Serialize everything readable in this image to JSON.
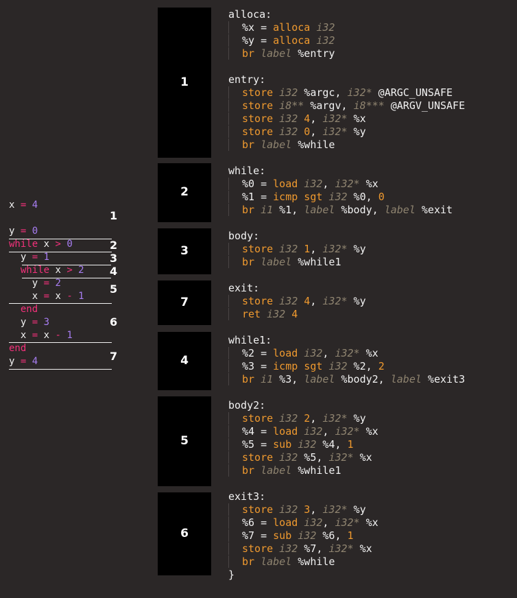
{
  "source_code": {
    "lines": [
      [
        {
          "c": "id",
          "t": "x "
        },
        {
          "c": "op",
          "t": "="
        },
        {
          "c": "num",
          "t": " 4"
        }
      ],
      [],
      [
        {
          "c": "id",
          "t": "y "
        },
        {
          "c": "op",
          "t": "="
        },
        {
          "c": "num",
          "t": " 0"
        }
      ],
      [
        {
          "c": "kw",
          "t": "while"
        },
        {
          "c": "id",
          "t": " x "
        },
        {
          "c": "op",
          "t": ">"
        },
        {
          "c": "num",
          "t": " 0"
        }
      ],
      [
        {
          "c": "id",
          "t": "  y "
        },
        {
          "c": "op",
          "t": "="
        },
        {
          "c": "num",
          "t": " 1"
        }
      ],
      [
        {
          "c": "kw",
          "t": "  while"
        },
        {
          "c": "id",
          "t": " x "
        },
        {
          "c": "op",
          "t": ">"
        },
        {
          "c": "num",
          "t": " 2"
        }
      ],
      [
        {
          "c": "id",
          "t": "    y "
        },
        {
          "c": "op",
          "t": "="
        },
        {
          "c": "num",
          "t": " 2"
        }
      ],
      [
        {
          "c": "id",
          "t": "    x "
        },
        {
          "c": "op",
          "t": "="
        },
        {
          "c": "id",
          "t": " x "
        },
        {
          "c": "op",
          "t": "-"
        },
        {
          "c": "num",
          "t": " 1"
        }
      ],
      [
        {
          "c": "kw",
          "t": "  end"
        }
      ],
      [
        {
          "c": "id",
          "t": "  y "
        },
        {
          "c": "op",
          "t": "="
        },
        {
          "c": "num",
          "t": " 3"
        }
      ],
      [
        {
          "c": "id",
          "t": "  x "
        },
        {
          "c": "op",
          "t": "="
        },
        {
          "c": "id",
          "t": " x "
        },
        {
          "c": "op",
          "t": "-"
        },
        {
          "c": "num",
          "t": " 1"
        }
      ],
      [
        {
          "c": "kw",
          "t": "end"
        }
      ],
      [
        {
          "c": "id",
          "t": "y "
        },
        {
          "c": "op",
          "t": "="
        },
        {
          "c": "num",
          "t": " 4"
        }
      ]
    ],
    "block_numbers": [
      "1",
      "2",
      "3",
      "4",
      "5",
      "6",
      "7"
    ]
  },
  "blocks": [
    "1",
    "2",
    "3",
    "7",
    "4",
    "5",
    "6"
  ],
  "ir": [
    [
      {
        "c": "w",
        "t": "alloca:"
      }
    ],
    [
      {
        "c": "i"
      },
      {
        "c": "w",
        "t": "%x = "
      },
      {
        "c": "k",
        "t": "alloca"
      },
      {
        "c": "t",
        "t": " i32"
      }
    ],
    [
      {
        "c": "i"
      },
      {
        "c": "w",
        "t": "%y = "
      },
      {
        "c": "k",
        "t": "alloca"
      },
      {
        "c": "t",
        "t": " i32"
      }
    ],
    [
      {
        "c": "i"
      },
      {
        "c": "k",
        "t": "br"
      },
      {
        "c": "t",
        "t": " label"
      },
      {
        "c": "w",
        "t": " %entry"
      }
    ],
    [],
    [
      {
        "c": "w",
        "t": "entry:"
      }
    ],
    [
      {
        "c": "i"
      },
      {
        "c": "k",
        "t": "store"
      },
      {
        "c": "t",
        "t": " i32"
      },
      {
        "c": "w",
        "t": " %argc, "
      },
      {
        "c": "t",
        "t": "i32*"
      },
      {
        "c": "w",
        "t": " @ARGC_UNSAFE"
      }
    ],
    [
      {
        "c": "i"
      },
      {
        "c": "k",
        "t": "store"
      },
      {
        "c": "t",
        "t": " i8**"
      },
      {
        "c": "w",
        "t": " %argv, "
      },
      {
        "c": "t",
        "t": "i8***"
      },
      {
        "c": "w",
        "t": " @ARGV_UNSAFE"
      }
    ],
    [
      {
        "c": "i"
      },
      {
        "c": "k",
        "t": "store"
      },
      {
        "c": "t",
        "t": " i32"
      },
      {
        "c": "n",
        "t": " 4"
      },
      {
        "c": "w",
        "t": ", "
      },
      {
        "c": "t",
        "t": "i32*"
      },
      {
        "c": "w",
        "t": " %x"
      }
    ],
    [
      {
        "c": "i"
      },
      {
        "c": "k",
        "t": "store"
      },
      {
        "c": "t",
        "t": " i32"
      },
      {
        "c": "n",
        "t": " 0"
      },
      {
        "c": "w",
        "t": ", "
      },
      {
        "c": "t",
        "t": "i32*"
      },
      {
        "c": "w",
        "t": " %y"
      }
    ],
    [
      {
        "c": "i"
      },
      {
        "c": "k",
        "t": "br"
      },
      {
        "c": "t",
        "t": " label"
      },
      {
        "c": "w",
        "t": " %while"
      }
    ],
    [],
    [
      {
        "c": "w",
        "t": "while:"
      }
    ],
    [
      {
        "c": "i"
      },
      {
        "c": "w",
        "t": "%0 = "
      },
      {
        "c": "k",
        "t": "load"
      },
      {
        "c": "t",
        "t": " i32"
      },
      {
        "c": "w",
        "t": ", "
      },
      {
        "c": "t",
        "t": "i32*"
      },
      {
        "c": "w",
        "t": " %x"
      }
    ],
    [
      {
        "c": "i"
      },
      {
        "c": "w",
        "t": "%1 = "
      },
      {
        "c": "k",
        "t": "icmp sgt"
      },
      {
        "c": "t",
        "t": " i32"
      },
      {
        "c": "w",
        "t": " %0, "
      },
      {
        "c": "n",
        "t": "0"
      }
    ],
    [
      {
        "c": "i"
      },
      {
        "c": "k",
        "t": "br"
      },
      {
        "c": "t",
        "t": " i1"
      },
      {
        "c": "w",
        "t": " %1, "
      },
      {
        "c": "t",
        "t": "label"
      },
      {
        "c": "w",
        "t": " %body, "
      },
      {
        "c": "t",
        "t": "label"
      },
      {
        "c": "w",
        "t": " %exit"
      }
    ],
    [],
    [
      {
        "c": "w",
        "t": "body:"
      }
    ],
    [
      {
        "c": "i"
      },
      {
        "c": "k",
        "t": "store"
      },
      {
        "c": "t",
        "t": " i32"
      },
      {
        "c": "n",
        "t": " 1"
      },
      {
        "c": "w",
        "t": ", "
      },
      {
        "c": "t",
        "t": "i32*"
      },
      {
        "c": "w",
        "t": " %y"
      }
    ],
    [
      {
        "c": "i"
      },
      {
        "c": "k",
        "t": "br"
      },
      {
        "c": "t",
        "t": " label"
      },
      {
        "c": "w",
        "t": " %while1"
      }
    ],
    [],
    [
      {
        "c": "w",
        "t": "exit:"
      }
    ],
    [
      {
        "c": "i"
      },
      {
        "c": "k",
        "t": "store"
      },
      {
        "c": "t",
        "t": " i32"
      },
      {
        "c": "n",
        "t": " 4"
      },
      {
        "c": "w",
        "t": ", "
      },
      {
        "c": "t",
        "t": "i32*"
      },
      {
        "c": "w",
        "t": " %y"
      }
    ],
    [
      {
        "c": "i"
      },
      {
        "c": "k",
        "t": "ret"
      },
      {
        "c": "t",
        "t": " i32"
      },
      {
        "c": "n",
        "t": " 4"
      }
    ],
    [],
    [
      {
        "c": "w",
        "t": "while1:"
      }
    ],
    [
      {
        "c": "i"
      },
      {
        "c": "w",
        "t": "%2 = "
      },
      {
        "c": "k",
        "t": "load"
      },
      {
        "c": "t",
        "t": " i32"
      },
      {
        "c": "w",
        "t": ", "
      },
      {
        "c": "t",
        "t": "i32*"
      },
      {
        "c": "w",
        "t": " %x"
      }
    ],
    [
      {
        "c": "i"
      },
      {
        "c": "w",
        "t": "%3 = "
      },
      {
        "c": "k",
        "t": "icmp sgt"
      },
      {
        "c": "t",
        "t": " i32"
      },
      {
        "c": "w",
        "t": " %2, "
      },
      {
        "c": "n",
        "t": "2"
      }
    ],
    [
      {
        "c": "i"
      },
      {
        "c": "k",
        "t": "br"
      },
      {
        "c": "t",
        "t": " i1"
      },
      {
        "c": "w",
        "t": " %3, "
      },
      {
        "c": "t",
        "t": "label"
      },
      {
        "c": "w",
        "t": " %body2, "
      },
      {
        "c": "t",
        "t": "label"
      },
      {
        "c": "w",
        "t": " %exit3"
      }
    ],
    [],
    [
      {
        "c": "w",
        "t": "body2:"
      }
    ],
    [
      {
        "c": "i"
      },
      {
        "c": "k",
        "t": "store"
      },
      {
        "c": "t",
        "t": " i32"
      },
      {
        "c": "n",
        "t": " 2"
      },
      {
        "c": "w",
        "t": ", "
      },
      {
        "c": "t",
        "t": "i32*"
      },
      {
        "c": "w",
        "t": " %y"
      }
    ],
    [
      {
        "c": "i"
      },
      {
        "c": "w",
        "t": "%4 = "
      },
      {
        "c": "k",
        "t": "load"
      },
      {
        "c": "t",
        "t": " i32"
      },
      {
        "c": "w",
        "t": ", "
      },
      {
        "c": "t",
        "t": "i32*"
      },
      {
        "c": "w",
        "t": " %x"
      }
    ],
    [
      {
        "c": "i"
      },
      {
        "c": "w",
        "t": "%5 = "
      },
      {
        "c": "k",
        "t": "sub"
      },
      {
        "c": "t",
        "t": " i32"
      },
      {
        "c": "w",
        "t": " %4, "
      },
      {
        "c": "n",
        "t": "1"
      }
    ],
    [
      {
        "c": "i"
      },
      {
        "c": "k",
        "t": "store"
      },
      {
        "c": "t",
        "t": " i32"
      },
      {
        "c": "w",
        "t": " %5, "
      },
      {
        "c": "t",
        "t": "i32*"
      },
      {
        "c": "w",
        "t": " %x"
      }
    ],
    [
      {
        "c": "i"
      },
      {
        "c": "k",
        "t": "br"
      },
      {
        "c": "t",
        "t": " label"
      },
      {
        "c": "w",
        "t": " %while1"
      }
    ],
    [],
    [
      {
        "c": "w",
        "t": "exit3:"
      }
    ],
    [
      {
        "c": "i"
      },
      {
        "c": "k",
        "t": "store"
      },
      {
        "c": "t",
        "t": " i32"
      },
      {
        "c": "n",
        "t": " 3"
      },
      {
        "c": "w",
        "t": ", "
      },
      {
        "c": "t",
        "t": "i32*"
      },
      {
        "c": "w",
        "t": " %y"
      }
    ],
    [
      {
        "c": "i"
      },
      {
        "c": "w",
        "t": "%6 = "
      },
      {
        "c": "k",
        "t": "load"
      },
      {
        "c": "t",
        "t": " i32"
      },
      {
        "c": "w",
        "t": ", "
      },
      {
        "c": "t",
        "t": "i32*"
      },
      {
        "c": "w",
        "t": " %x"
      }
    ],
    [
      {
        "c": "i"
      },
      {
        "c": "w",
        "t": "%7 = "
      },
      {
        "c": "k",
        "t": "sub"
      },
      {
        "c": "t",
        "t": " i32"
      },
      {
        "c": "w",
        "t": " %6, "
      },
      {
        "c": "n",
        "t": "1"
      }
    ],
    [
      {
        "c": "i"
      },
      {
        "c": "k",
        "t": "store"
      },
      {
        "c": "t",
        "t": " i32"
      },
      {
        "c": "w",
        "t": " %7, "
      },
      {
        "c": "t",
        "t": "i32*"
      },
      {
        "c": "w",
        "t": " %x"
      }
    ],
    [
      {
        "c": "i"
      },
      {
        "c": "k",
        "t": "br"
      },
      {
        "c": "t",
        "t": " label"
      },
      {
        "c": "w",
        "t": " %while"
      }
    ],
    [
      {
        "c": "w",
        "t": "}"
      }
    ]
  ],
  "colors": {
    "background": "#2b2727",
    "keyword": "#f4317b",
    "number": "#a87ef3",
    "ir_keyword": "#f09a2f",
    "ir_type": "#8f8470",
    "block_fill": "#000000"
  }
}
